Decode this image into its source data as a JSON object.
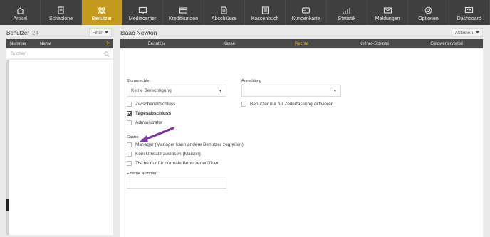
{
  "nav": {
    "items": [
      {
        "label": "Artikel",
        "icon": "artikel-icon",
        "active": false
      },
      {
        "label": "Schablone",
        "icon": "schablone-icon",
        "active": false
      },
      {
        "label": "Benutzer",
        "icon": "benutzer-icon",
        "active": true
      },
      {
        "label": "Mediacenter",
        "icon": "mediacenter-icon",
        "active": false
      },
      {
        "label": "Kreditkunden",
        "icon": "kreditkunden-icon",
        "active": false
      },
      {
        "label": "Abschlüsse",
        "icon": "abschluesse-icon",
        "active": false
      },
      {
        "label": "Kassenbuch",
        "icon": "kassenbuch-icon",
        "active": false
      },
      {
        "label": "Kundenkarte",
        "icon": "kundenkarte-icon",
        "active": false
      },
      {
        "label": "Statistik",
        "icon": "statistik-icon",
        "active": false
      },
      {
        "label": "Meldungen",
        "icon": "meldungen-icon",
        "active": false
      },
      {
        "label": "Optionen",
        "icon": "optionen-icon",
        "active": false
      },
      {
        "label": "Dashboard",
        "icon": "dashboard-icon",
        "active": false
      }
    ],
    "active_color": "#c49a1e"
  },
  "left": {
    "title": "Benutzer",
    "count": "24",
    "filter_label": "Filter",
    "columns": {
      "number": "Nummer",
      "name": "Name",
      "add": "+"
    },
    "search_placeholder": "Suchen"
  },
  "right": {
    "title": "Isaac Newton",
    "actions_label": "Aktionen",
    "tabs": [
      {
        "label": "Benutzer",
        "active": false
      },
      {
        "label": "Kasse",
        "active": false
      },
      {
        "label": "Rechte",
        "active": true
      },
      {
        "label": "Kellner-Schloss",
        "active": false
      },
      {
        "label": "Geldwertervorteil",
        "active": false
      }
    ],
    "form": {
      "stornorechte_label": "Stornorechte",
      "stornorechte_value": "Keine Berechtigung",
      "anmeldung_label": "Anmeldung",
      "anmeldung_value": "",
      "zeiterfassung_label": "Benutzer nur für Zeiterfassung aktivieren",
      "zwischenabschluss_label": "Zwischenabschluss",
      "tagesabschluss_label": "Tagesabschluss",
      "administrator_label": "Administrator",
      "gastro_label": "Gastro",
      "manager_label": "Manager (Manager kann andere Benutzer zugreifen)",
      "kein_umsatz_label": "Kein Umsatz auslösen (Maison)",
      "tische_label": "Tische nur für normale Benutzer eröffnen",
      "externe_nummer_label": "Externe Nummer",
      "externe_nummer_value": ""
    },
    "checked": {
      "tagesabschluss": true
    }
  },
  "colors": {
    "accent": "#e3b92b",
    "nav_bg": "#3f3f3f",
    "header_bg": "#4a4a4a",
    "arrow": "#7b3a9e"
  }
}
